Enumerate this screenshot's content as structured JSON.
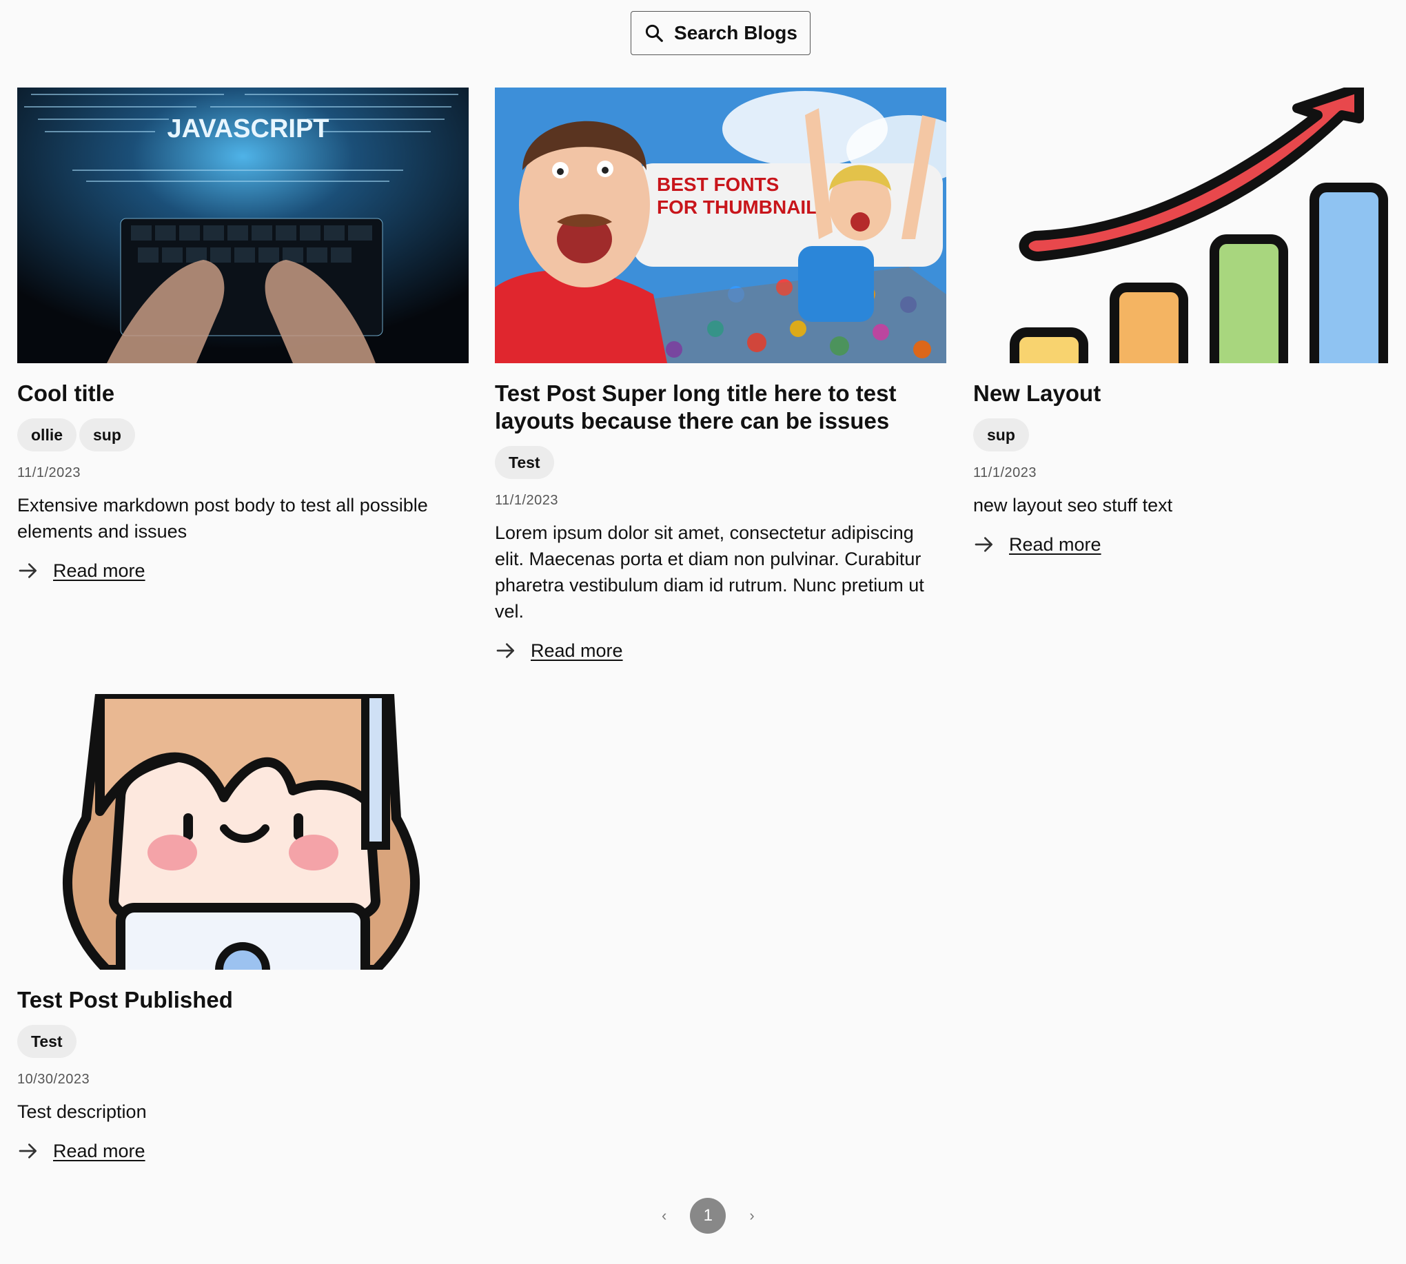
{
  "search": {
    "label": "Search Blogs"
  },
  "posts": [
    {
      "title": "Cool title",
      "tags": [
        "ollie",
        "sup"
      ],
      "date": "11/1/2023",
      "description": "Extensive markdown post body to test all possible elements and issues",
      "read_more": "Read more",
      "image_text": "JAVASCRIPT"
    },
    {
      "title": "Test Post Super long title here to test layouts because there can be issues",
      "tags": [
        "Test"
      ],
      "date": "11/1/2023",
      "description": "Lorem ipsum dolor sit amet, consectetur adipiscing elit. Maecenas porta et diam non pulvinar. Curabitur pharetra vestibulum diam id rutrum. Nunc pretium ut vel.",
      "read_more": "Read more",
      "image_text": [
        "BEST FONTS",
        "FOR THUMBNAILS"
      ]
    },
    {
      "title": "New Layout",
      "tags": [
        "sup"
      ],
      "date": "11/1/2023",
      "description": "new layout seo stuff text",
      "read_more": "Read more"
    },
    {
      "title": "Test Post Published",
      "tags": [
        "Test"
      ],
      "date": "10/30/2023",
      "description": "Test description",
      "read_more": "Read more"
    }
  ],
  "pagination": {
    "prev": "‹",
    "current": "1",
    "next": "›"
  },
  "colors": {
    "background": "#fafafa",
    "tag_bg": "#ececec",
    "page_active": "#888888"
  }
}
